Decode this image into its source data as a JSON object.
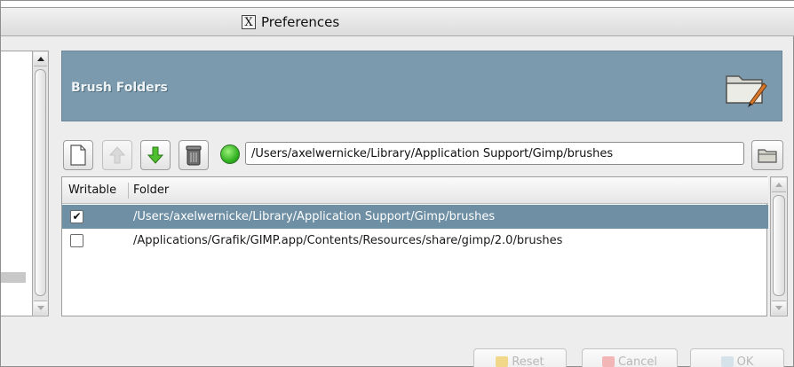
{
  "window": {
    "title": "Preferences",
    "title_icon": "x-window-icon"
  },
  "banner": {
    "title": "Brush Folders",
    "icon": "folder-brush-icon",
    "color": "#7b9aad"
  },
  "toolbar": {
    "buttons": [
      {
        "name": "new-folder-button",
        "icon": "new-document-icon",
        "enabled": true
      },
      {
        "name": "move-up-button",
        "icon": "arrow-up-icon",
        "enabled": false
      },
      {
        "name": "move-down-button",
        "icon": "arrow-down-icon",
        "enabled": true
      },
      {
        "name": "delete-button",
        "icon": "trash-can-icon",
        "enabled": true
      }
    ],
    "status": "valid",
    "status_color": "#33b322",
    "path_value": "/Users/axelwernicke/Library/Application Support/Gimp/brushes",
    "browse_icon": "open-folder-icon"
  },
  "list": {
    "headers": {
      "writable": "Writable",
      "folder": "Folder"
    },
    "rows": [
      {
        "writable": true,
        "check": "✔",
        "path": "/Users/axelwernicke/Library/Application Support/Gimp/brushes",
        "selected": true
      },
      {
        "writable": false,
        "check": "",
        "path": "/Applications/Grafik/GIMP.app/Contents/Resources/share/gimp/2.0/brushes",
        "selected": false
      }
    ]
  },
  "buttons": {
    "reset": "Reset",
    "cancel": "Cancel",
    "ok": "OK"
  }
}
